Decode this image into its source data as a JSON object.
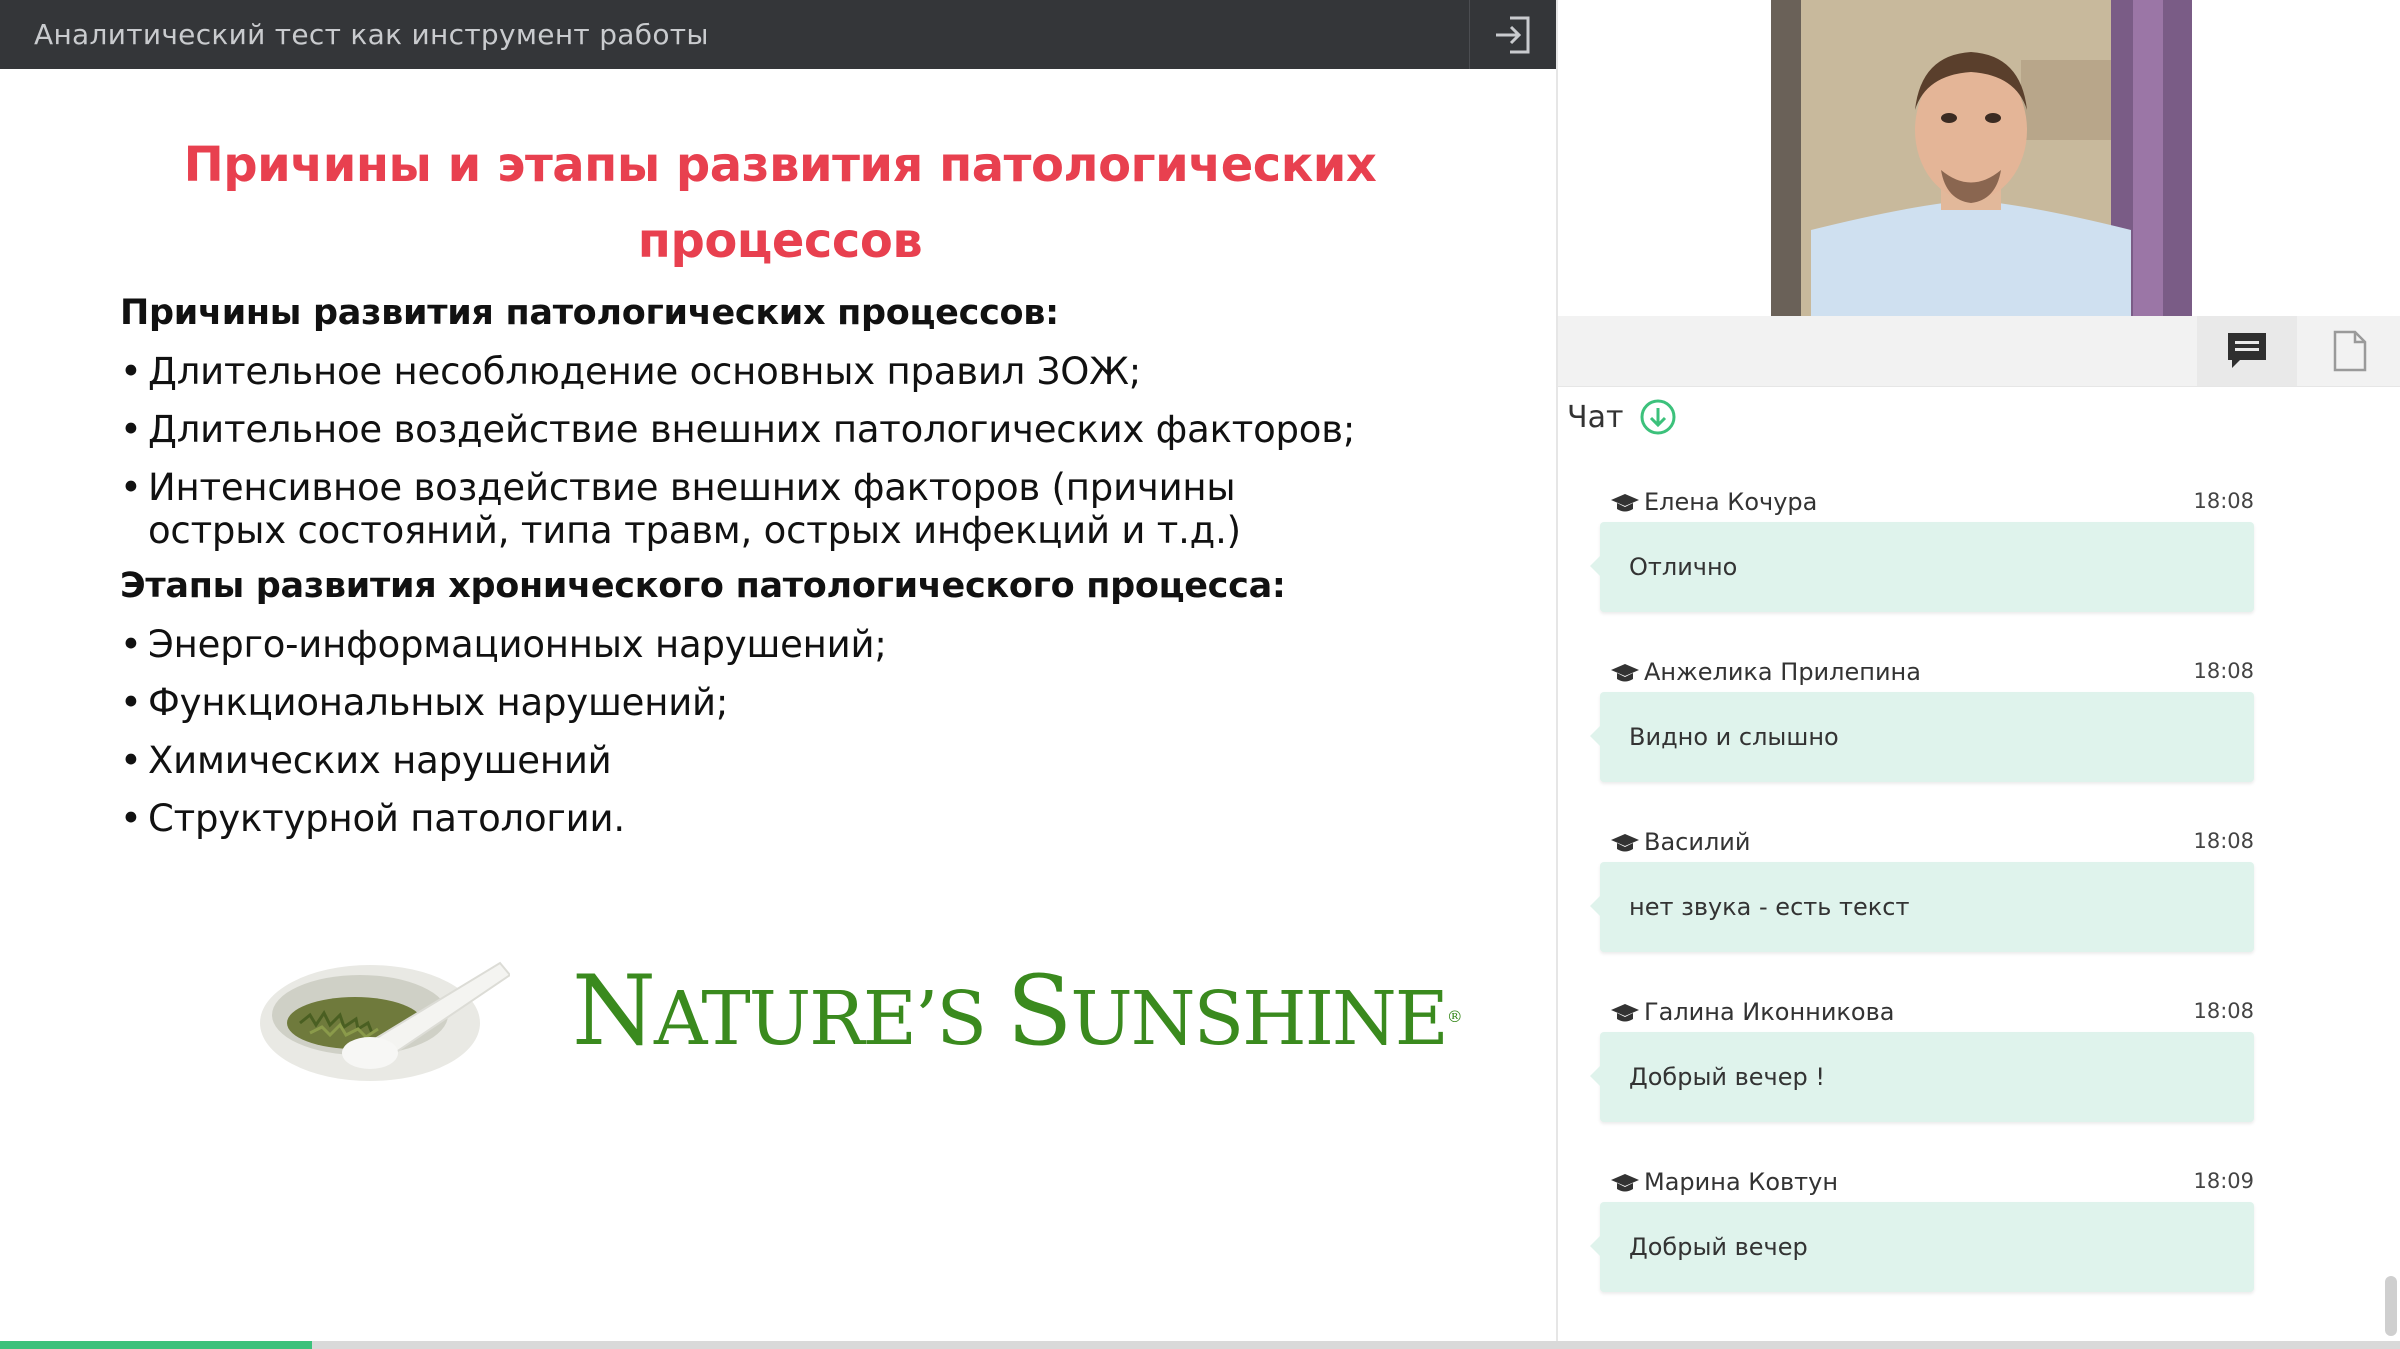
{
  "topbar": {
    "title": "Аналитический тест как инструмент работы"
  },
  "slide": {
    "title": "Причины и этапы развития патологических процессов",
    "section1_heading": "Причины развития патологических процессов:",
    "section1_items": [
      "Длительное несоблюдение основных правил ЗОЖ;",
      "Длительное воздействие внешних патологических факторов;",
      "Интенсивное воздействие внешних факторов (причины острых состояний, типа травм, острых инфекций и т.д.)"
    ],
    "section2_heading": "Этапы развития хронического патологического процесса:",
    "section2_items": [
      "Энерго-информационных нарушений;",
      "Функциональных нарушений;",
      "Химических нарушений",
      "Структурной патологии."
    ],
    "logo_text": "Nature's Sunshine",
    "logo_mark": "®"
  },
  "progress": {
    "value_percent": 13
  },
  "chat": {
    "title": "Чат",
    "messages": [
      {
        "author": "Елена Кочура",
        "time": "18:08",
        "text": "Отлично"
      },
      {
        "author": "Анжелика Прилепина",
        "time": "18:08",
        "text": "Видно и слышно"
      },
      {
        "author": "Василий",
        "time": "18:08",
        "text": "нет звука - есть текст"
      },
      {
        "author": "Галина Иконникова",
        "time": "18:08",
        "text": "Добрый вечер !"
      },
      {
        "author": "Марина Ковтун",
        "time": "18:09",
        "text": "Добрый вечер"
      }
    ]
  },
  "colors": {
    "accent": "#3cc17b",
    "title_red": "#e8404f",
    "logo_green": "#3a8a1e",
    "bubble": "#dff3ec",
    "topbar": "#343639"
  },
  "icons": {
    "exit": "exit-icon",
    "chat_tab": "chat-icon",
    "docs_tab": "document-icon",
    "chat_scroll": "arrow-down-circle-icon",
    "author": "graduation-cap-icon"
  }
}
